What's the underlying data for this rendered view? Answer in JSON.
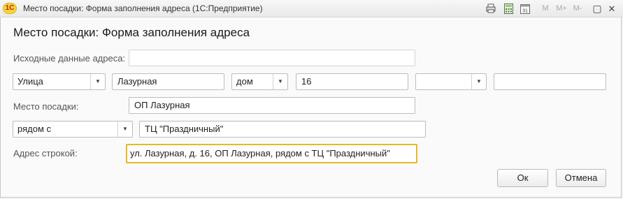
{
  "window": {
    "logo_text": "1С",
    "title": "Место посадки: Форма заполнения адреса  (1С:Предприятие)",
    "toolbar_icons": [
      "printer-icon",
      "calculator-icon",
      "calendar-icon"
    ],
    "calendar_day": "31",
    "memory_buttons": {
      "m": "M",
      "m_plus": "M+",
      "m_minus": "M-"
    },
    "controls": {
      "restore": "▢",
      "close": "✕"
    }
  },
  "form": {
    "heading": "Место посадки: Форма заполнения адреса",
    "source_label": "Исходные данные адреса:",
    "source_value": "",
    "street_type": "Улица",
    "street_name": "Лазурная",
    "house_type": "дом",
    "house_number": "16",
    "extra_type": "",
    "extra_value": "",
    "place_label": "Место посадки:",
    "place_value": "ОП Лазурная",
    "relation": "рядом с",
    "landmark": "ТЦ \"Праздничный\"",
    "address_label": "Адрес строкой:",
    "address_value": "ул. Лазурная, д. 16, ОП Лазурная, рядом с ТЦ \"Праздничный\""
  },
  "buttons": {
    "ok": "Ок",
    "cancel": "Отмена"
  },
  "colors": {
    "active_border": "#e6b727",
    "logo_bg": "#f6d53a",
    "logo_text": "#c0201b"
  }
}
